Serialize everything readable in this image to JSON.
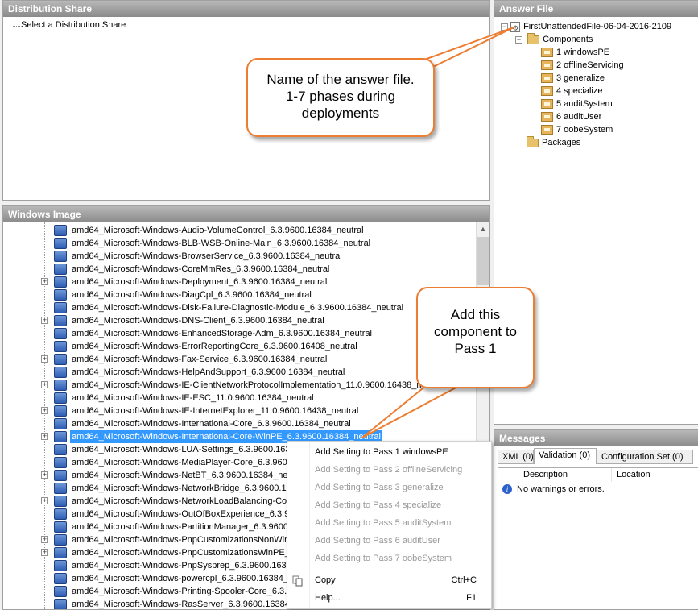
{
  "distribution_share": {
    "title": "Distribution Share",
    "root_item": "Select a Distribution Share"
  },
  "answer_file": {
    "title": "Answer File",
    "file_name": "FirstUnattendedFile-06-04-2016-2109",
    "components_label": "Components",
    "passes": [
      "1 windowsPE",
      "2 offlineServicing",
      "3 generalize",
      "4 specialize",
      "5 auditSystem",
      "6 auditUser",
      "7 oobeSystem"
    ],
    "packages_label": "Packages"
  },
  "windows_image": {
    "title": "Windows Image",
    "items": [
      {
        "label": "amd64_Microsoft-Windows-Audio-VolumeControl_6.3.9600.16384_neutral",
        "expandable": false
      },
      {
        "label": "amd64_Microsoft-Windows-BLB-WSB-Online-Main_6.3.9600.16384_neutral",
        "expandable": false
      },
      {
        "label": "amd64_Microsoft-Windows-BrowserService_6.3.9600.16384_neutral",
        "expandable": false
      },
      {
        "label": "amd64_Microsoft-Windows-CoreMmRes_6.3.9600.16384_neutral",
        "expandable": false
      },
      {
        "label": "amd64_Microsoft-Windows-Deployment_6.3.9600.16384_neutral",
        "expandable": true
      },
      {
        "label": "amd64_Microsoft-Windows-DiagCpl_6.3.9600.16384_neutral",
        "expandable": false
      },
      {
        "label": "amd64_Microsoft-Windows-Disk-Failure-Diagnostic-Module_6.3.9600.16384_neutral",
        "expandable": false
      },
      {
        "label": "amd64_Microsoft-Windows-DNS-Client_6.3.9600.16384_neutral",
        "expandable": true
      },
      {
        "label": "amd64_Microsoft-Windows-EnhancedStorage-Adm_6.3.9600.16384_neutral",
        "expandable": false
      },
      {
        "label": "amd64_Microsoft-Windows-ErrorReportingCore_6.3.9600.16408_neutral",
        "expandable": false
      },
      {
        "label": "amd64_Microsoft-Windows-Fax-Service_6.3.9600.16384_neutral",
        "expandable": true
      },
      {
        "label": "amd64_Microsoft-Windows-HelpAndSupport_6.3.9600.16384_neutral",
        "expandable": false
      },
      {
        "label": "amd64_Microsoft-Windows-IE-ClientNetworkProtocolImplementation_11.0.9600.16438_neutral",
        "expandable": true
      },
      {
        "label": "amd64_Microsoft-Windows-IE-ESC_11.0.9600.16384_neutral",
        "expandable": false
      },
      {
        "label": "amd64_Microsoft-Windows-IE-InternetExplorer_11.0.9600.16438_neutral",
        "expandable": true
      },
      {
        "label": "amd64_Microsoft-Windows-International-Core_6.3.9600.16384_neutral",
        "expandable": false
      },
      {
        "label": "amd64_Microsoft-Windows-International-Core-WinPE_6.3.9600.16384_neutral",
        "expandable": true,
        "selected": true
      },
      {
        "label": "amd64_Microsoft-Windows-LUA-Settings_6.3.9600.16384_neutral",
        "expandable": false
      },
      {
        "label": "amd64_Microsoft-Windows-MediaPlayer-Core_6.3.9600.16384_neutral",
        "expandable": false
      },
      {
        "label": "amd64_Microsoft-Windows-NetBT_6.3.9600.16384_neutral",
        "expandable": true
      },
      {
        "label": "amd64_Microsoft-Windows-NetworkBridge_6.3.9600.16384_neutral",
        "expandable": false
      },
      {
        "label": "amd64_Microsoft-Windows-NetworkLoadBalancing-Core_6.3.9600.16384_neutral",
        "expandable": true
      },
      {
        "label": "amd64_Microsoft-Windows-OutOfBoxExperience_6.3.9600.16384_neutral",
        "expandable": false
      },
      {
        "label": "amd64_Microsoft-Windows-PartitionManager_6.3.9600.16384_neutral",
        "expandable": false
      },
      {
        "label": "amd64_Microsoft-Windows-PnpCustomizationsNonWinPE_6.3.9600.16384_neutral",
        "expandable": true
      },
      {
        "label": "amd64_Microsoft-Windows-PnpCustomizationsWinPE_6.3.9600.16384_neutral",
        "expandable": true
      },
      {
        "label": "amd64_Microsoft-Windows-PnpSysprep_6.3.9600.16384_neutral",
        "expandable": false
      },
      {
        "label": "amd64_Microsoft-Windows-powercpl_6.3.9600.16384_neutral",
        "expandable": false
      },
      {
        "label": "amd64_Microsoft-Windows-Printing-Spooler-Core_6.3.9600.16384_neutral",
        "expandable": false
      },
      {
        "label": "amd64_Microsoft-Windows-RasServer_6.3.9600.16384_neutral",
        "expandable": false
      }
    ]
  },
  "messages": {
    "title": "Messages",
    "tabs": [
      "XML (0)",
      "Validation (0)",
      "Configuration Set (0)"
    ],
    "active_tab": "Validation (0)",
    "columns": [
      "Description",
      "Location"
    ],
    "rows": [
      "No warnings or errors."
    ]
  },
  "context_menu": {
    "items": [
      {
        "label": "Add Setting to Pass 1 windowsPE",
        "enabled": true
      },
      {
        "label": "Add Setting to Pass 2 offlineServicing",
        "enabled": false
      },
      {
        "label": "Add Setting to Pass 3 generalize",
        "enabled": false
      },
      {
        "label": "Add Setting to Pass 4 specialize",
        "enabled": false
      },
      {
        "label": "Add Setting to Pass 5 auditSystem",
        "enabled": false
      },
      {
        "label": "Add Setting to Pass 6 auditUser",
        "enabled": false
      },
      {
        "label": "Add Setting to Pass 7 oobeSystem",
        "enabled": false
      }
    ],
    "copy_label": "Copy",
    "copy_shortcut": "Ctrl+C",
    "help_label": "Help...",
    "help_shortcut": "F1"
  },
  "callouts": {
    "answer_file_note": [
      "Name of the answer file.",
      "1-7 phases during",
      "deployments"
    ],
    "add_component_note": [
      "Add this",
      "component to",
      "Pass 1"
    ]
  },
  "colors": {
    "accent_orange": "#ed7d31",
    "selection_blue": "#3399ff"
  }
}
